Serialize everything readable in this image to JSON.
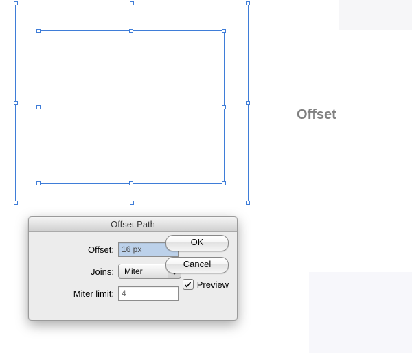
{
  "side_label": "Offset",
  "dialog": {
    "title": "Offset Path",
    "offset_label": "Offset:",
    "offset_value": "16 px",
    "joins_label": "Joins:",
    "joins_value": "Miter",
    "miter_limit_label": "Miter limit:",
    "miter_limit_value": "4",
    "ok_label": "OK",
    "cancel_label": "Cancel",
    "preview_label": "Preview",
    "preview_checked": true
  },
  "colors": {
    "selection": "#3f7dd8"
  }
}
